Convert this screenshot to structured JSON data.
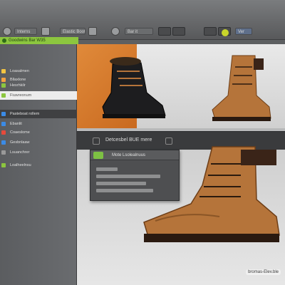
{
  "toolbar": {
    "tab1": "Interns",
    "tab2": "Elastic Boots",
    "tab3": "Bar it",
    "tab4": "Ver"
  },
  "address": {
    "text": "Goodwins Bar W35"
  },
  "sidebar": {
    "items": [
      {
        "label": "Loasalmen",
        "color": "#f4c542"
      },
      {
        "label": "Bllaxlone",
        "color": "#f4a142"
      },
      {
        "label": "Hesrhkilr",
        "color": "#8cc63f"
      },
      {
        "label": "Fiuwreonum",
        "color": "#8cc63f"
      },
      {
        "label": "Pasteboat rollem",
        "color": "#3b8be6"
      },
      {
        "label": "Ebanlit",
        "color": "#3b8be6"
      },
      {
        "label": "Coaeslome",
        "color": "#e64a3b"
      },
      {
        "label": "Gesbnlaaw",
        "color": "#3b8be6"
      },
      {
        "label": "Lsuanchrer",
        "color": "#999999"
      },
      {
        "label": "Loalheelnsu",
        "color": "#8cc63f"
      }
    ]
  },
  "main": {
    "mid_title": "Detcesbel BUE mere",
    "popup_title": "Mote Lsolealnuus",
    "brand": "bromas-Elev.ble"
  },
  "colors": {
    "accent_green": "#8cc63f",
    "boot_brown": "#b5743a",
    "orange_bg": "#d9782a"
  }
}
